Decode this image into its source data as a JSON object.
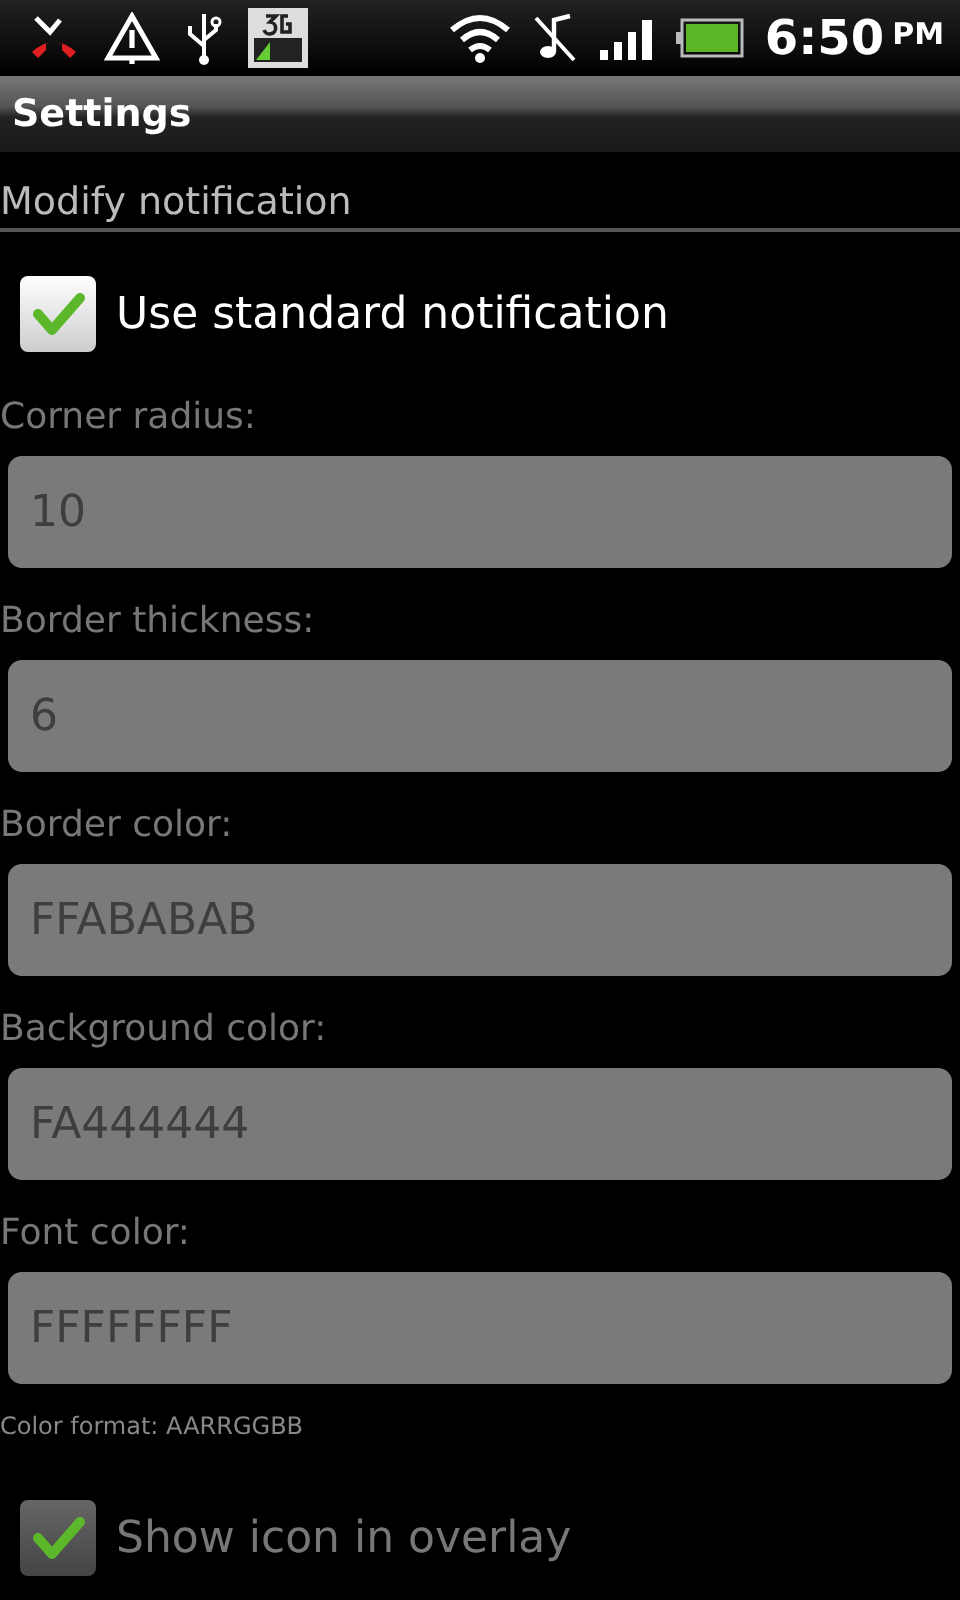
{
  "status_bar": {
    "time": "6:50",
    "ampm": "PM"
  },
  "title_bar": {
    "title": "Settings"
  },
  "section": {
    "title": "Modify notification"
  },
  "use_standard": {
    "label": "Use standard notification",
    "checked": true,
    "disabled": false
  },
  "fields": [
    {
      "label": "Corner radius:",
      "value": "10",
      "disabled": true
    },
    {
      "label": "Border thickness:",
      "value": "6",
      "disabled": true
    },
    {
      "label": "Border color:",
      "value": "FFABABAB",
      "disabled": true
    },
    {
      "label": "Background color:",
      "value": "FA444444",
      "disabled": true
    },
    {
      "label": "Font color:",
      "value": "FFFFFFFF",
      "disabled": true
    }
  ],
  "hint": "Color format: AARRGGBB",
  "show_icon": {
    "label": "Show icon in overlay",
    "checked": true,
    "disabled": true
  }
}
